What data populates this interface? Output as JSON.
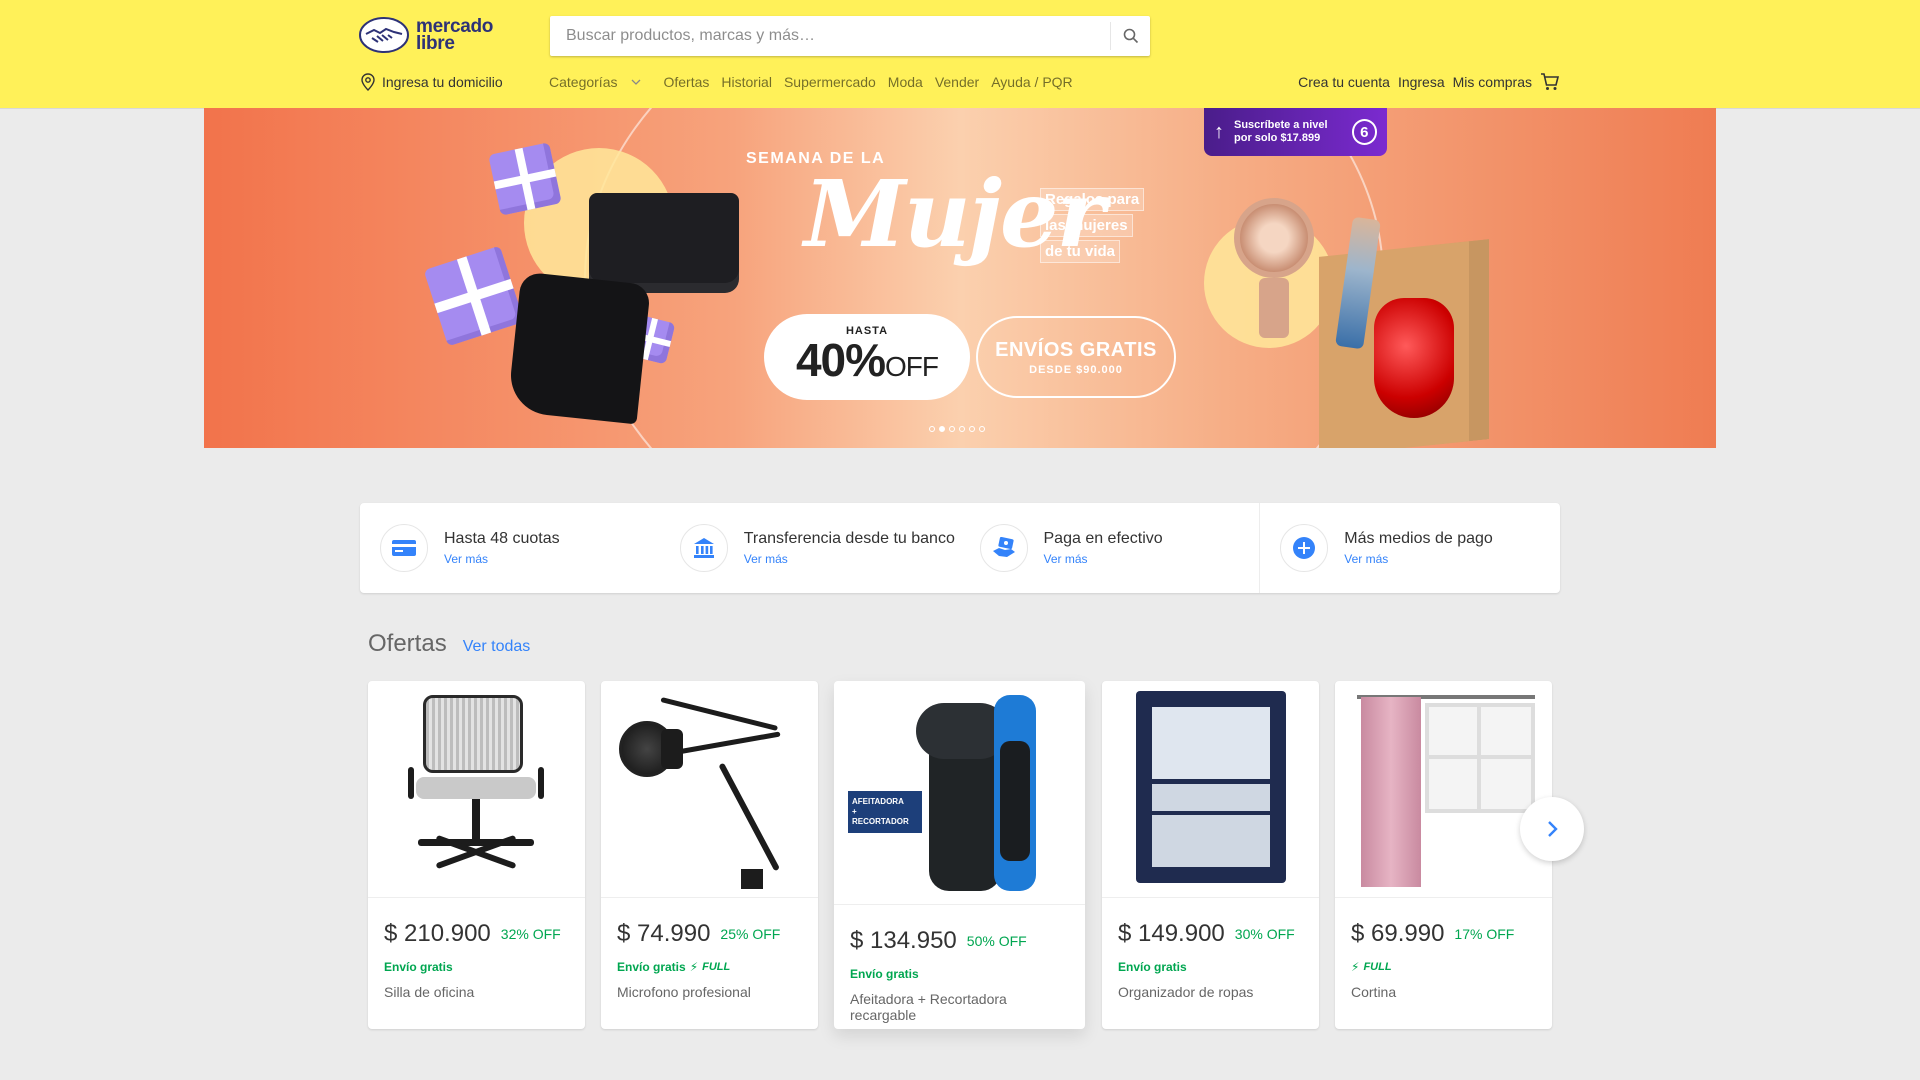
{
  "header": {
    "logo": {
      "line1": "mercado",
      "line2": "libre"
    },
    "search": {
      "placeholder": "Buscar productos, marcas y más…"
    },
    "location_label": "Ingresa tu domicilio",
    "nav": [
      "Categorías",
      "Ofertas",
      "Historial",
      "Supermercado",
      "Moda",
      "Vender",
      "Ayuda / PQR"
    ],
    "user_links": [
      "Crea tu cuenta",
      "Ingresa",
      "Mis compras"
    ]
  },
  "hero": {
    "subscribe_line1": "Suscríbete a nivel",
    "subscribe_line2": "por solo $17.899",
    "subscribe_badge": "6",
    "kicker": "SEMANA DE LA",
    "title": "Mujer",
    "gifts_lines": [
      "Regalos para",
      "las mujeres",
      "de tu vida"
    ],
    "discount_small": "HASTA",
    "discount_big": "40%",
    "discount_suffix": "OFF",
    "shipping_big": "ENVÍOS GRATIS",
    "shipping_small": "DESDE $90.000",
    "slides_total": 6,
    "active_slide": 2
  },
  "payments": [
    {
      "icon": "credit-card-icon",
      "title": "Hasta 48 cuotas",
      "link": "Ver más"
    },
    {
      "icon": "bank-icon",
      "title": "Transferencia desde tu banco",
      "link": "Ver más"
    },
    {
      "icon": "cash-handshake-icon",
      "title": "Paga en efectivo",
      "link": "Ver más"
    },
    {
      "icon": "plus-icon",
      "title": "Más medios de pago",
      "link": "Ver más"
    }
  ],
  "offers": {
    "title": "Ofertas",
    "link": "Ver todas",
    "items": [
      {
        "price": "$ 210.900",
        "discount": "32% OFF",
        "shipping": "Envío gratis",
        "full": "",
        "name": "Silla de oficina"
      },
      {
        "price": "$ 74.990",
        "discount": "25% OFF",
        "shipping": "Envío gratis",
        "full": "FULL",
        "name": "Microfono profesional"
      },
      {
        "price": "$ 134.950",
        "discount": "50% OFF",
        "shipping": "Envío gratis",
        "full": "",
        "name": "Afeitadora + Recortadora recargable",
        "badge_line1": "AFEITADORA",
        "badge_line2": "+",
        "badge_line3": "RECORTADOR"
      },
      {
        "price": "$ 149.900",
        "discount": "30% OFF",
        "shipping": "Envío gratis",
        "full": "",
        "name": "Organizador de ropas"
      },
      {
        "price": "$ 69.990",
        "discount": "17% OFF",
        "shipping": "",
        "full": "FULL",
        "name": "Cortina"
      }
    ]
  },
  "colors": {
    "header_bg": "#fff159",
    "link_blue": "#3483fa",
    "green": "#00a650",
    "page_bg": "#ebebeb"
  }
}
